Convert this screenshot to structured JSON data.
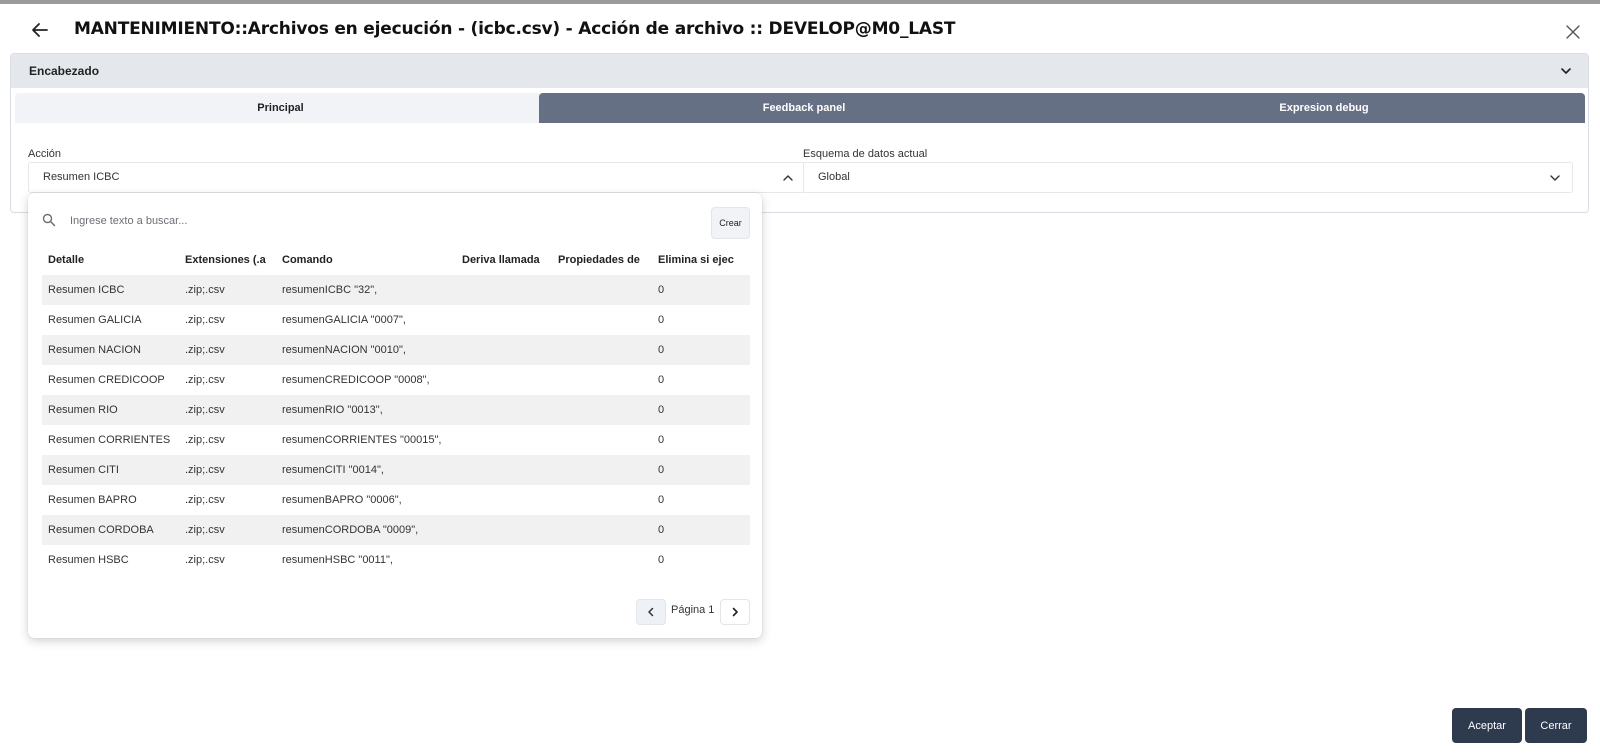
{
  "window": {
    "title": "MANTENIMIENTO::Archivos en ejecución - (icbc.csv) - Acción de archivo :: DEVELOP@M0_LAST",
    "back_icon": "arrow-left-icon",
    "close_icon": "close-icon"
  },
  "section": {
    "title": "Encabezado",
    "expanded": true,
    "toggle_icon": "chevron-down-icon"
  },
  "tabs": [
    {
      "label": "Principal",
      "active": true
    },
    {
      "label": "Feedback panel",
      "active": false
    },
    {
      "label": "Expresion debug",
      "active": false
    }
  ],
  "form": {
    "accion": {
      "label": "Acción",
      "value": "Resumen ICBC",
      "open": true
    },
    "esquema": {
      "label": "Esquema de datos actual",
      "value": "Global"
    }
  },
  "dropdown": {
    "search_placeholder": "Ingrese texto a buscar...",
    "create_label": "Crear",
    "columns": [
      "Detalle",
      "Extensiones (.a",
      "Comando",
      "Deriva llamada",
      "Propiedades de",
      "Elimina si ejec"
    ],
    "rows": [
      [
        "Resumen ICBC",
        ".zip;.csv",
        "resumenICBC \"32\",",
        "",
        "",
        "0"
      ],
      [
        "Resumen GALICIA",
        ".zip;.csv",
        "resumenGALICIA \"0007\",",
        "",
        "",
        "0"
      ],
      [
        "Resumen NACION",
        ".zip;.csv",
        "resumenNACION \"0010\",",
        "",
        "",
        "0"
      ],
      [
        "Resumen CREDICOOP",
        ".zip;.csv",
        "resumenCREDICOOP \"0008\",",
        "",
        "",
        "0"
      ],
      [
        "Resumen RIO",
        ".zip;.csv",
        "resumenRIO \"0013\",",
        "",
        "",
        "0"
      ],
      [
        "Resumen CORRIENTES",
        ".zip;.csv",
        "resumenCORRIENTES \"00015\",",
        "",
        "",
        "0"
      ],
      [
        "Resumen CITI",
        ".zip;.csv",
        "resumenCITI \"0014\",",
        "",
        "",
        "0"
      ],
      [
        "Resumen BAPRO",
        ".zip;.csv",
        "resumenBAPRO \"0006\",",
        "",
        "",
        "0"
      ],
      [
        "Resumen CORDOBA",
        ".zip;.csv",
        "resumenCORDOBA \"0009\",",
        "",
        "",
        "0"
      ],
      [
        "Resumen HSBC",
        ".zip;.csv",
        "resumenHSBC \"0011\",",
        "",
        "",
        "0"
      ]
    ],
    "pagination": {
      "label": "Página 1"
    }
  },
  "footer": {
    "accept_label": "Aceptar",
    "close_label": "Cerrar"
  },
  "colors": {
    "tab_inactive": "#667085",
    "tab_active": "#f1f3f6",
    "button_dark": "#2e3a4e",
    "row_stripe": "#f1f1f2"
  }
}
